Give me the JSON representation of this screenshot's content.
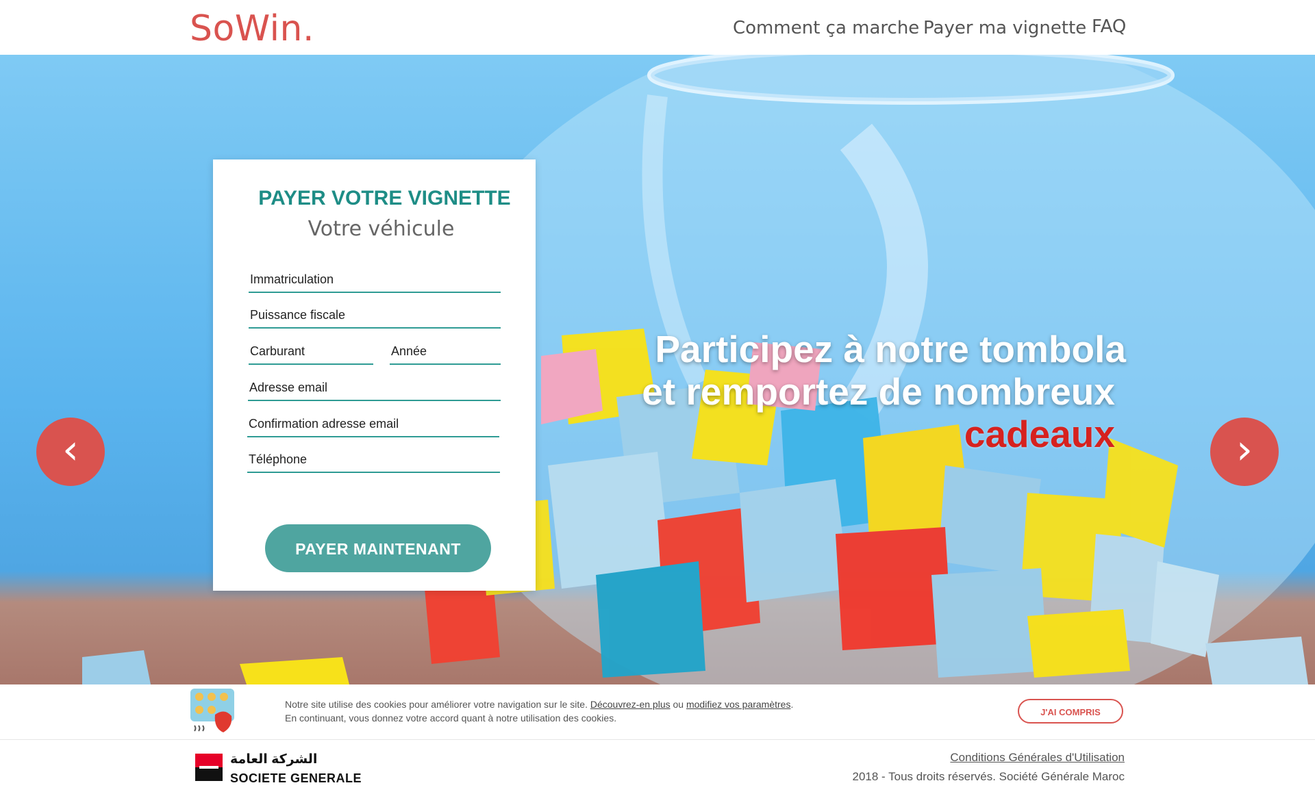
{
  "header": {
    "logo": "SoWin.",
    "nav": [
      "Comment ça marche",
      "Payer ma vignette",
      "FAQ"
    ]
  },
  "form": {
    "title": "PAYER VOTRE VIGNETTE",
    "subtitle": "Votre véhicule",
    "fields": {
      "immatriculation": "Immatriculation",
      "puissance": "Puissance fiscale",
      "carburant": "Carburant",
      "annee": "Année",
      "email": "Adresse email",
      "email_confirm": "Confirmation adresse email",
      "telephone": "Téléphone"
    },
    "submit_label": "PAYER MAINTENANT"
  },
  "hero": {
    "line1": "Participez à notre tombola",
    "line2": "et remportez de nombreux",
    "line3": "cadeaux",
    "prev_icon": "chevron-left-icon",
    "next_icon": "chevron-right-icon"
  },
  "cookie": {
    "text1": "Notre site utilise des cookies pour améliorer votre navigation sur le site.",
    "link1": "Découvrez-en plus",
    "joiner": "ou",
    "link2": "modifiez vos paramètres",
    "end": ".",
    "text2": "En continuant, vous donnez votre accord quant à notre utilisation des cookies.",
    "agree_label": "J'AI COMPRIS"
  },
  "footer": {
    "brand_ar": "الشركة العامة",
    "brand_en": "SOCIETE GENERALE",
    "cgu": "Conditions Générales d'Utilisation",
    "copyright": "2018 - Tous droits réservés. Société Générale Maroc"
  },
  "colors": {
    "brand_red": "#d9534f",
    "teal": "#1e8d86",
    "button_teal": "#4fa5a0",
    "headline_red": "#d6221f"
  }
}
